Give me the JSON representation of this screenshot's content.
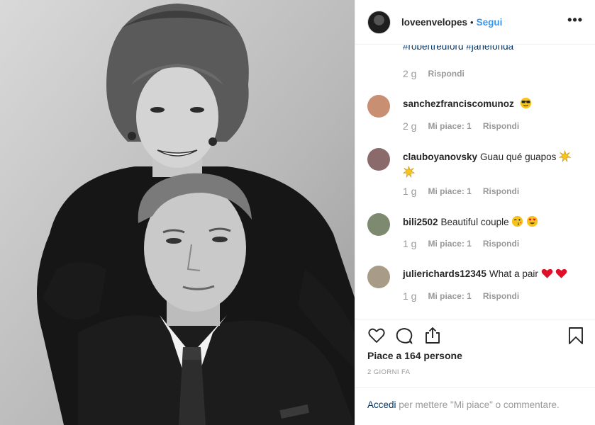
{
  "post": {
    "image_alt": "black and white portrait photo"
  },
  "header": {
    "username": "loveenvelopes",
    "separator": "•",
    "follow": "Segui",
    "more": "•••"
  },
  "caption_tail": {
    "text": "#robertredford #janefonda",
    "age": "2 g",
    "reply": "Rispondi"
  },
  "comments": [
    {
      "user": "sanchezfranciscomunoz",
      "text": "",
      "emojis": [
        "sunglasses-emoji"
      ],
      "age": "2 g",
      "likes": "Mi piace: 1",
      "reply": "Rispondi",
      "avatar_color": "#c98f73"
    },
    {
      "user": "clauboyanovsky",
      "text": "Guau qué guapos",
      "emojis": [
        "sparkle-star-emoji",
        "sparkle-star-emoji"
      ],
      "age": "1 g",
      "likes": "Mi piace: 1",
      "reply": "Rispondi",
      "avatar_color": "#8a6a6a"
    },
    {
      "user": "bili2502",
      "text": "Beautiful couple",
      "emojis": [
        "kiss-wink-emoji",
        "heart-eyes-emoji"
      ],
      "age": "1 g",
      "likes": "Mi piace: 1",
      "reply": "Rispondi",
      "avatar_color": "#7d8a6f"
    },
    {
      "user": "julierichards12345",
      "text": "What a pair",
      "emojis": [
        "red-heart-emoji",
        "red-heart-emoji"
      ],
      "age": "1 g",
      "likes": "Mi piace: 1",
      "reply": "Rispondi",
      "avatar_color": "#a89b88"
    }
  ],
  "actions": {
    "like_icon": "heart-outline-icon",
    "comment_icon": "speech-bubble-icon",
    "share_icon": "share-upload-icon",
    "save_icon": "bookmark-icon"
  },
  "likes_text": "Piace a 164 persone",
  "timestamp": "2 GIORNI FA",
  "footer": {
    "login": "Accedi",
    "rest": " per mettere \"Mi piace\" o commentare."
  },
  "colors": {
    "link": "#003569",
    "follow": "#3897f0",
    "muted": "#999999",
    "heart_red": "#e0102a"
  }
}
